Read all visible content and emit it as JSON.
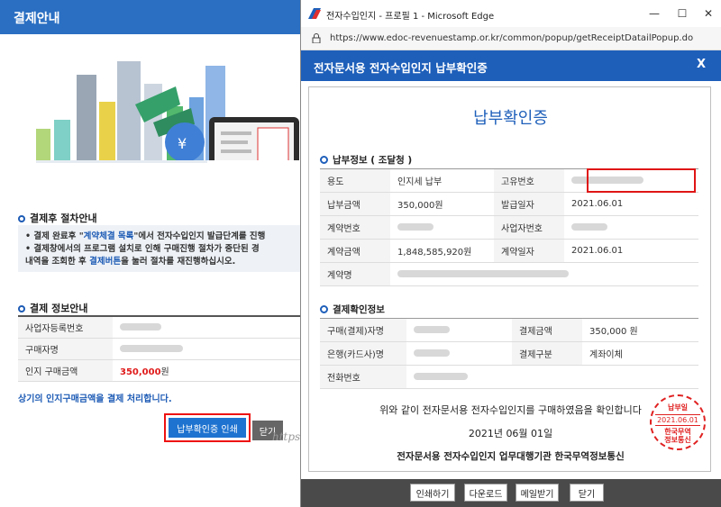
{
  "bg": {
    "title": "결제안내",
    "procedure_title": "결제후 절차안내",
    "procedure_line1_prefix": "• 결제 완료후 \"",
    "procedure_line1_link": "계약체결 목록",
    "procedure_line1_suffix": "\"에서 전자수입인지 발급단계를 진행",
    "procedure_line2": "• 결제창에서의 프로그램 설치로 인해 구매진행 절차가 중단된 경",
    "procedure_line3_prefix": "  내역을 조회한 후 ",
    "procedure_line3_link": "결제버튼",
    "procedure_line3_suffix": "을 눌러 절차를 재진행하십시오.",
    "payinfo_title": "결제 정보안내",
    "rows": [
      {
        "label": "사업자등록번호",
        "value": ""
      },
      {
        "label": "구매자명",
        "value": ""
      },
      {
        "label": "인지 구매금액",
        "value": "350,000",
        "unit": "원"
      }
    ],
    "process_note": "상기의 인지구매금액을 결제 처리합니다.",
    "print_button": "납부확인증 인쇄",
    "close_button": "닫기",
    "watermark": "https://blog.naver.com/ahsoug"
  },
  "window": {
    "title": "전자수입인지 - 프로필 1 - Microsoft Edge",
    "minimize": "—",
    "maximize": "☐",
    "close": "✕",
    "url": "https://www.edoc-revenuestamp.or.kr/common/popup/getReceiptDatailPopup.do"
  },
  "popup": {
    "header": "전자문서용 전자수입인지 납부확인증",
    "close": "X",
    "cert_title": "납부확인증",
    "section1": "납부정보 ( 조달청 )",
    "section2": "결제확인정보",
    "pay_rows": [
      {
        "k1": "용도",
        "v1": "인지세 납부",
        "k2": "고유번호",
        "v2": ""
      },
      {
        "k1": "납부금액",
        "v1": "350,000원",
        "k2": "발급일자",
        "v2": "2021.06.01"
      },
      {
        "k1": "계약번호",
        "v1": "",
        "k2": "사업자번호",
        "v2": ""
      },
      {
        "k1": "계약금액",
        "v1": "1,848,585,920원",
        "k2": "계약일자",
        "v2": "2021.06.01"
      },
      {
        "k1": "계약명",
        "v1": ""
      }
    ],
    "confirm_rows": [
      {
        "k1": "구매(결제)자명",
        "v1": "",
        "k2": "결제금액",
        "v2": "350,000 원"
      },
      {
        "k1": "은행(카드사)명",
        "v1": "",
        "k2": "결제구분",
        "v2": "계좌이체"
      },
      {
        "k1": "전화번호",
        "v1": ""
      }
    ],
    "confirm_text": "위와 같이 전자문서용 전자수입인지를 구매하였음을 확인합니다",
    "confirm_date": "2021년 06월 01일",
    "confirm_org": "전자문서용 전자수입인지 업무대행기관 한국무역정보통신",
    "stamp": {
      "top": "납부일",
      "date": "2021.06.01",
      "org1": "한국무역",
      "org2": "정보통신"
    },
    "buttons": {
      "print": "인쇄하기",
      "download": "다운로드",
      "mail": "메일받기",
      "close": "닫기"
    }
  },
  "colors": {
    "accent": "#1e5fba",
    "highlight_box": "#e01515",
    "price": "#e01b1b"
  }
}
